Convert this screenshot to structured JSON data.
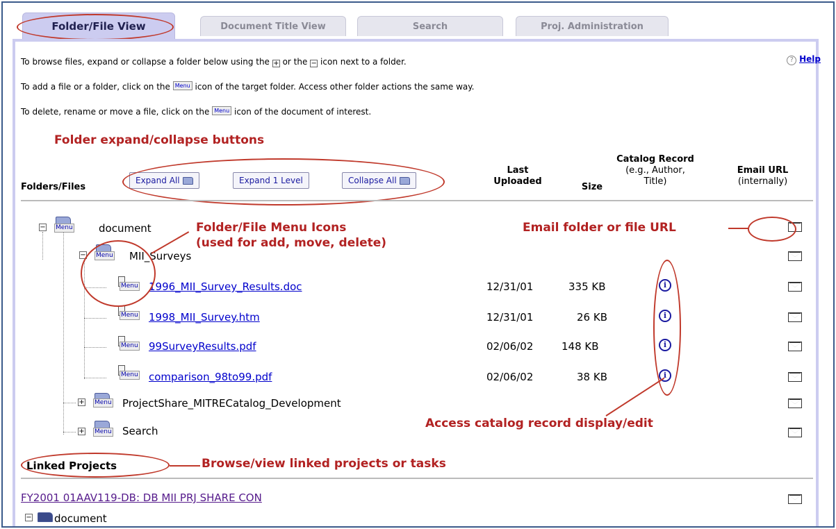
{
  "tabs": [
    {
      "label": "Folder/File View",
      "active": true
    },
    {
      "label": "Document Title View",
      "active": false
    },
    {
      "label": "Search",
      "active": false
    },
    {
      "label": "Proj. Administration",
      "active": false
    }
  ],
  "help": {
    "label": "Help"
  },
  "instructions": {
    "line1a": "To browse files, expand or collapse a folder below using the",
    "line1b": "or the",
    "line1c": "icon next to a folder.",
    "line2a": "To add a file or a folder, click on the",
    "line2b": "icon of the target folder. Access other folder actions the same way.",
    "line3a": "To delete, rename or move a file, click on the",
    "line3b": "icon of the document of interest.",
    "menu_chip": "Menu"
  },
  "annotations": {
    "expand_collapse": "Folder expand/collapse buttons",
    "menu_icons_1": "Folder/File Menu Icons",
    "menu_icons_2": "(used for add, move, delete)",
    "email_url": "Email folder or file URL",
    "catalog": "Access catalog record display/edit",
    "linked": "Browse/view linked projects or tasks"
  },
  "columns": {
    "folders_files": "Folders/Files",
    "last_uploaded_1": "Last",
    "last_uploaded_2": "Uploaded",
    "size": "Size",
    "catalog_1": "Catalog Record",
    "catalog_2": "(e.g., Author,",
    "catalog_3": "Title)",
    "email_1": "Email URL",
    "email_2": "(internally)"
  },
  "buttons": {
    "expand_all": "Expand All",
    "expand_1": "Expand 1 Level",
    "collapse_all": "Collapse All"
  },
  "tree": {
    "root": "document",
    "subfolder": "MII_Surveys",
    "files": [
      {
        "name": "1996_MII_Survey_Results.doc",
        "date": "12/31/01",
        "size": "335 KB"
      },
      {
        "name": "1998_MII_Survey.htm",
        "date": "12/31/01",
        "size": "26 KB"
      },
      {
        "name": "99SurveyResults.pdf",
        "date": "02/06/02",
        "size": "148 KB"
      },
      {
        "name": "comparison_98to99.pdf",
        "date": "02/06/02",
        "size": "38 KB"
      }
    ],
    "folder2": "ProjectShare_MITRECatalog_Development",
    "folder3": "Search",
    "menu_label": "Menu"
  },
  "linked": {
    "title": "Linked Projects",
    "project_link": "FY2001 01AAV119-DB: DB MII PRJ SHARE CON",
    "project_folder": "document"
  },
  "colors": {
    "accent": "#ccccf0",
    "annotation": "#b22222",
    "link": "#0000cc"
  }
}
